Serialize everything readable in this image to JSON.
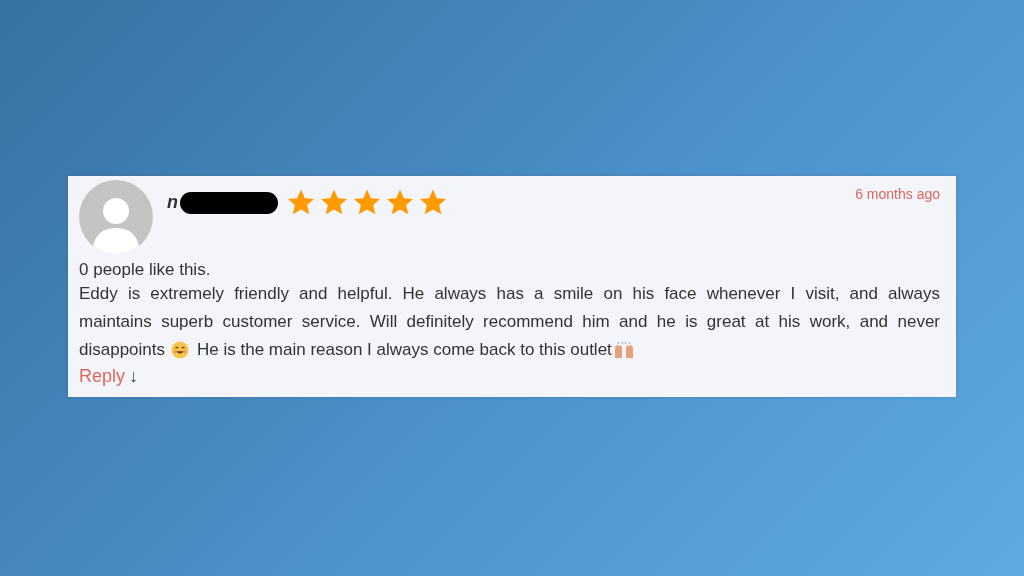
{
  "review": {
    "name": "n",
    "time": "6 months ago",
    "stars": 5,
    "likes": "0 people like this.",
    "lines": [
      [
        {
          "kind": "text",
          "text": "Eddy is extremely friendly and helpful. He always has a smile on his face whenever I visit, and always"
        }
      ],
      [
        {
          "kind": "text",
          "text": "maintains superb customer service. Will definitely recommend him and he is great at his work, and never"
        }
      ],
      [
        {
          "kind": "text",
          "text": "disappoints"
        },
        {
          "kind": "smile"
        },
        {
          "kind": "text",
          "text": "He is the main reason I always come back to this outlet"
        },
        {
          "kind": "hands"
        }
      ]
    ],
    "reply": "Reply",
    "reply_arrow": "↓"
  }
}
